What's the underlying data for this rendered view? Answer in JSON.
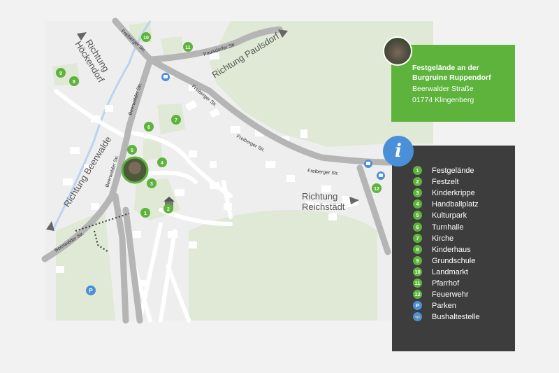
{
  "map": {
    "streets": {
      "freiberger_top": "Freiberger Str.",
      "freiberger_mid": "Freiberger Str.",
      "freiberger_diag": "Freiberger Str.",
      "freiberger_east": "Freiberger Str.",
      "paulsdorfer": "Paulsdorfer Str.",
      "beerwalder_n": "Beerwalder Str.",
      "beerwalder_mid": "Beerwalder Str.",
      "beerwalder_sw": "Beerwalder Str."
    },
    "directions": {
      "hoeckendorf_1": "Richtung",
      "hoeckendorf_2": "Höckendorf",
      "paulsdorf": "Richtung Paulsdorf",
      "beerwalde": "Richtung Beerwalde",
      "reichstaedt_1": "Richtung",
      "reichstaedt_2": "Reichstädt"
    },
    "pins": [
      {
        "num": "1"
      },
      {
        "num": "2"
      },
      {
        "num": "3"
      },
      {
        "num": "4"
      },
      {
        "num": "5"
      },
      {
        "num": "6"
      },
      {
        "num": "7"
      },
      {
        "num": "8"
      },
      {
        "num": "9"
      },
      {
        "num": "10"
      },
      {
        "num": "11"
      },
      {
        "num": "12"
      }
    ],
    "parking_symbol": "P"
  },
  "infobox": {
    "title": "Festgelände an der Burgruine Ruppendorf",
    "street": "Beerwalder Straße",
    "city": "01774 Klingenberg"
  },
  "legend": {
    "info_symbol": "i",
    "items": [
      {
        "badge": "1",
        "label": "Festgelände"
      },
      {
        "badge": "2",
        "label": "Festzelt"
      },
      {
        "badge": "3",
        "label": "Kinderkrippe"
      },
      {
        "badge": "4",
        "label": "Handballplatz"
      },
      {
        "badge": "5",
        "label": "Kulturpark"
      },
      {
        "badge": "6",
        "label": "Turnhalle"
      },
      {
        "badge": "7",
        "label": "Kirche"
      },
      {
        "badge": "8",
        "label": "Kinderhaus"
      },
      {
        "badge": "9",
        "label": "Grundschule"
      },
      {
        "badge": "10",
        "label": "Landmarkt"
      },
      {
        "badge": "11",
        "label": "Pfarrhof"
      },
      {
        "badge": "12",
        "label": "Feuerwehr"
      },
      {
        "badge": "P",
        "label": "Parken"
      },
      {
        "badge": "🚌",
        "label": "Bushaltestelle"
      }
    ]
  },
  "colors": {
    "accent_green": "#5db33c",
    "info_blue": "#4a90d9",
    "legend_bg": "#3d3d3d",
    "park_green": "#dfe9d5"
  }
}
